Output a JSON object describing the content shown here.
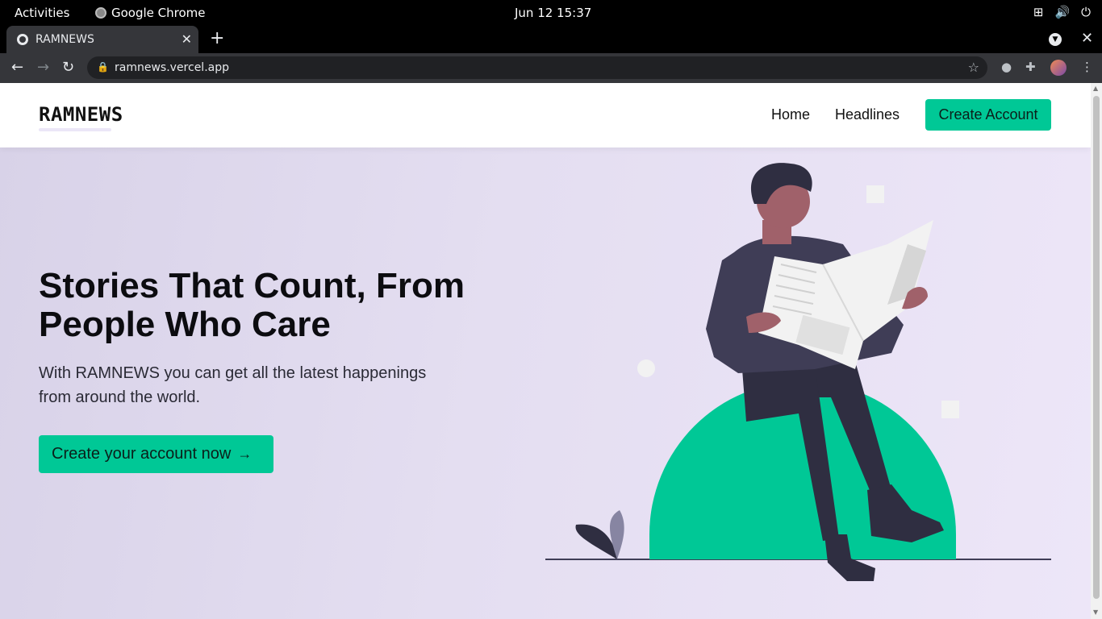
{
  "system": {
    "activities": "Activities",
    "app_name": "Google Chrome",
    "clock": "Jun 12  15:37"
  },
  "browser": {
    "tab_title": "RAMNEWS",
    "url": "ramnews.vercel.app"
  },
  "site": {
    "logo": "RAMNEWS",
    "nav": {
      "home": "Home",
      "headlines": "Headlines",
      "create_account": "Create Account"
    },
    "hero": {
      "title": "Stories That Count, From People Who Care",
      "subtitle": "With RAMNEWS you can get all the latest happenings from around the world.",
      "cta": "Create your account now",
      "cta_arrow": "→"
    }
  },
  "colors": {
    "accent": "#00c896",
    "page_bg": "#e4def1",
    "figure_dark": "#2f2e41",
    "skin": "#a0616a"
  }
}
